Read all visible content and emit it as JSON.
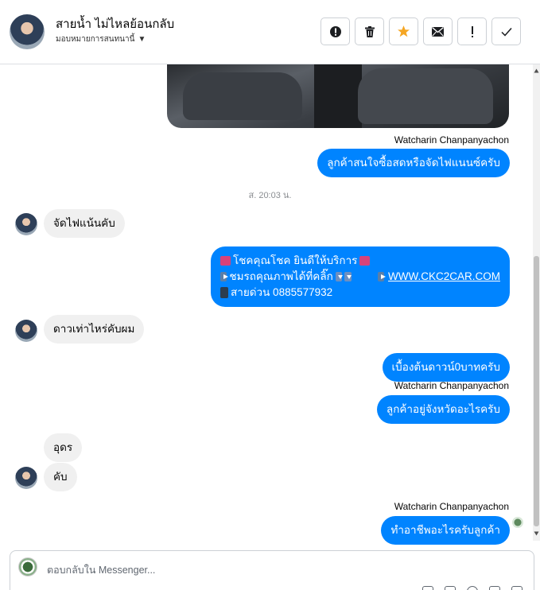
{
  "header": {
    "name": "สายน้ำ ไม่ไหลย้อนกลับ",
    "assign_label": "มอบหมายการสนทนานี้",
    "actions": [
      "spam-icon",
      "trash-icon",
      "star-icon",
      "mail-icon",
      "flag-icon",
      "done-icon"
    ]
  },
  "messages": {
    "sender_1": "Watcharin Chanpanyachon",
    "out_1": "ลูกค้าสนใจซื้อสดหรือจัดไฟแนนซ์ครับ",
    "timestamp_1": "ส. 20:03 น.",
    "in_1": "จัดไฟแน้นคับ",
    "promo_line_1": "โชคคุณโชค ยินดีให้บริการ",
    "promo_line_2": "ชมรถคุณภาพได้ที่คลิ๊ก",
    "promo_link": "WWW.CKC2CAR.COM",
    "promo_line_3": "สายด่วน 0885577932",
    "in_2": "ดาวเท่าไหร่คับผม",
    "out_2": "เบื้องต้นดาวน์0บาทครับ",
    "sender_2": "Watcharin Chanpanyachon",
    "out_3": "ลูกค้าอยู่จังหวัดอะไรครับ",
    "in_3": "อุดร",
    "in_4": "คับ",
    "sender_3": "Watcharin Chanpanyachon",
    "out_4": "ทำอาชีพอะไรครับลูกค้า"
  },
  "composer": {
    "placeholder": "ตอบกลับใน Messenger..."
  },
  "colors": {
    "outgoing_bubble": "#0084ff",
    "incoming_bubble": "#f0f0f0",
    "star_accent": "#f5a623"
  }
}
